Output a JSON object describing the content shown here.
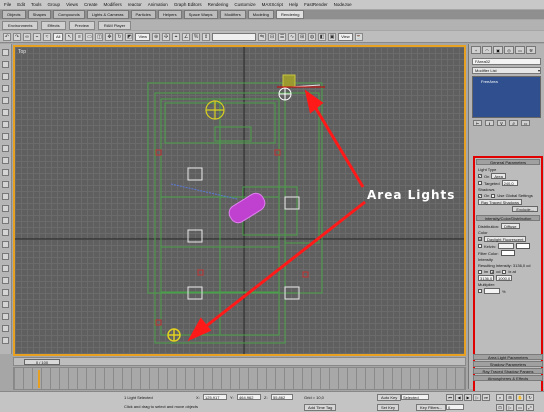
{
  "menu": [
    "File",
    "Edit",
    "Tools",
    "Group",
    "Views",
    "Create",
    "Modifiers",
    "reactor",
    "Animation",
    "Graph Editors",
    "Rendering",
    "Customize",
    "MAXScript",
    "Help",
    "FastRender",
    "NodeJoe"
  ],
  "main_tabs": [
    "Objects",
    "Shapes",
    "Compounds",
    "Lights & Cameras",
    "Particles",
    "Helpers",
    "Space Warps",
    "Modifiers",
    "Modeling",
    "Rendering"
  ],
  "sub_tabs": [
    "Environments",
    "Effects",
    "Preview",
    "RAM Player"
  ],
  "toolbar": {
    "selection_filter": "All",
    "ref_coord": "View",
    "named_sets": "",
    "view_drop": "View"
  },
  "viewport": {
    "label": "Top",
    "annotation": "Area Lights"
  },
  "command_panel": {
    "object_name": "FArea02",
    "modifier_list": "Modifier List",
    "stack_item": "FreeArea",
    "tabs": [
      "+",
      "◠",
      "▣",
      "◎",
      "▭",
      "⚒"
    ],
    "tools": [
      "⊢",
      "‖",
      "∀",
      "∂",
      "▭"
    ]
  },
  "general_parameters": {
    "title": "General Parameters",
    "light_type_label": "Light Type",
    "on_label": "On",
    "on_checked": true,
    "light_type": "Area",
    "targeted_label": "Targeted",
    "targeted_value": "240,0",
    "targeted_checked": false,
    "shadows_label": "Shadows",
    "shadows_on_label": "On",
    "use_global_label": "Use Global Settings",
    "shadow_type": "Ray Traced Shadows",
    "exclude_button": "Exclude..."
  },
  "intensity": {
    "title": "Intensity/Color/Distribution",
    "distribution_label": "Distribution:",
    "distribution": "Diffuse",
    "color_label": "Color",
    "color_preset": "Daylight Fluorescent",
    "kelvin_label": "Kelvin:",
    "filter_color_label": "Filter Color:",
    "intensity_label": "Intensity",
    "resulting_label": "Resulting Intensity: 3136,0 cd",
    "units": [
      "lm",
      "cd",
      "lx at"
    ],
    "intensity_value": "3136,0",
    "lx_value": "1000,0",
    "multiplier_label": "Multiplier:",
    "multiplier_value": "",
    "multiplier_pct": "%"
  },
  "bottom_rollouts": [
    "Area Light Parameters",
    "Shadow Parameters",
    "Ray Traced Shadow Params",
    "Atmospheres & Effects"
  ],
  "timeline": {
    "slider": "0 / 100"
  },
  "status": {
    "selected": "1 Light Selected",
    "prompt": "Click and drag to select and move objects",
    "x_label": "X:",
    "x_value": "125,917",
    "y_label": "Y:",
    "y_value": "464,962",
    "z_label": "Z:",
    "z_value": "55,862",
    "grid": "Grid = 10,0",
    "add_time_tag": "Add Time Tag",
    "auto_key": "Auto Key",
    "auto_key_mode": "Selected",
    "set_key": "Set Key",
    "key_filters": "Key Filters...",
    "frame": "0"
  },
  "colors": {
    "viewport_border": "#e8a020",
    "highlight": "#e00000",
    "light_yellow": "#d8d020",
    "geometry_green": "#49a04a",
    "selected_magenta": "#c040d0"
  }
}
